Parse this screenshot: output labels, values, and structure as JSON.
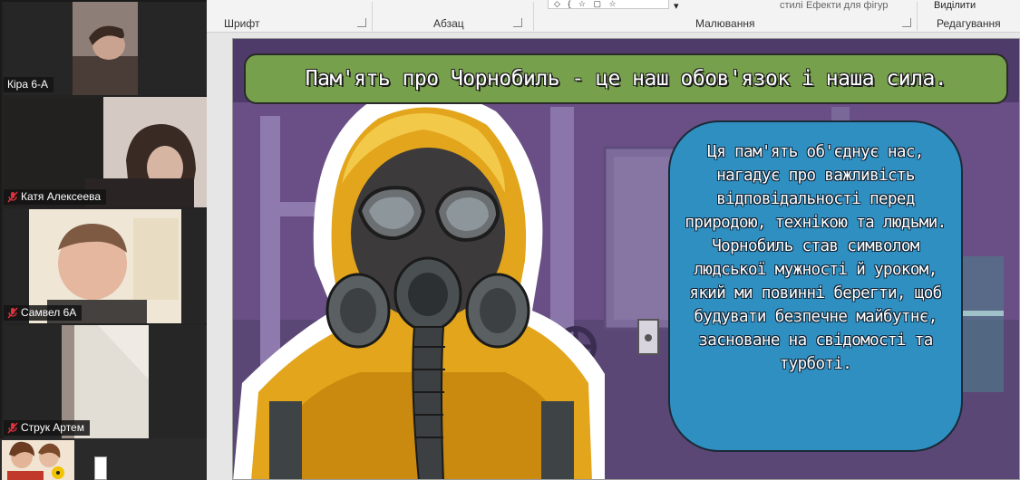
{
  "ribbon": {
    "groups": [
      {
        "label": "Шрифт"
      },
      {
        "label": "Абзац"
      },
      {
        "label": "Малювання"
      },
      {
        "label": "Редагування"
      }
    ],
    "top_items": {
      "styles": "стилі",
      "shape_effects": "Ефекти для фігур",
      "select": "Виділити"
    },
    "shape_symbols": "◇ { ☆ ▢ ☆"
  },
  "slide": {
    "title": "Пам'ять про Чорнобиль - це наш обов'язок і наша сила.",
    "bubble_text": "Ця пам'ять об'єднує нас, нагадує про важливість відповідальності перед природою, технікою та людьми. Чорнобиль став символом людської мужності й уроком, який ми повинні берегти, щоб будувати безпечне майбутнє, засноване на свідомості та турботі.",
    "colors": {
      "title_bg": "#77a04c",
      "bubble_bg": "#2f8fc1",
      "suit": "#e2a51b",
      "background": "#6a4f86"
    }
  },
  "participants": [
    {
      "name": "Кіра 6-А",
      "muted": false
    },
    {
      "name": "Катя Алексеева",
      "muted": true
    },
    {
      "name": "Самвел 6А",
      "muted": true
    },
    {
      "name": "Струк Артем",
      "muted": true
    }
  ]
}
